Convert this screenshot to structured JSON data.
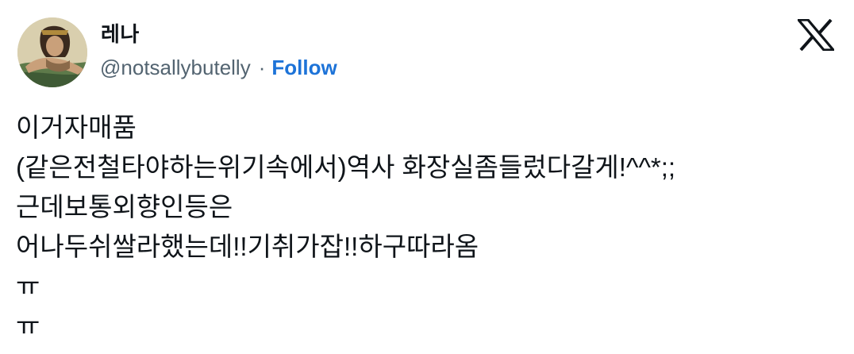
{
  "author": {
    "display_name": "레나",
    "handle": "@notsallybutelly",
    "separator": "·",
    "follow_label": "Follow"
  },
  "brand": {
    "logo_icon": "x-logo-icon",
    "logo_color": "#0f1419"
  },
  "colors": {
    "follow": "#1d73d8",
    "handle": "#536471",
    "text": "#0f1419"
  },
  "tweet": {
    "lines": [
      "이거자매품",
      "(같은전철타야하는위기속에서)역사 화장실좀들렀다갈게!^^*;;",
      "근데보통외향인등은",
      "어나두쉬쌀라했는데!!기취가잡!!하구따라옴",
      "ㅠ",
      "ㅠ"
    ]
  }
}
